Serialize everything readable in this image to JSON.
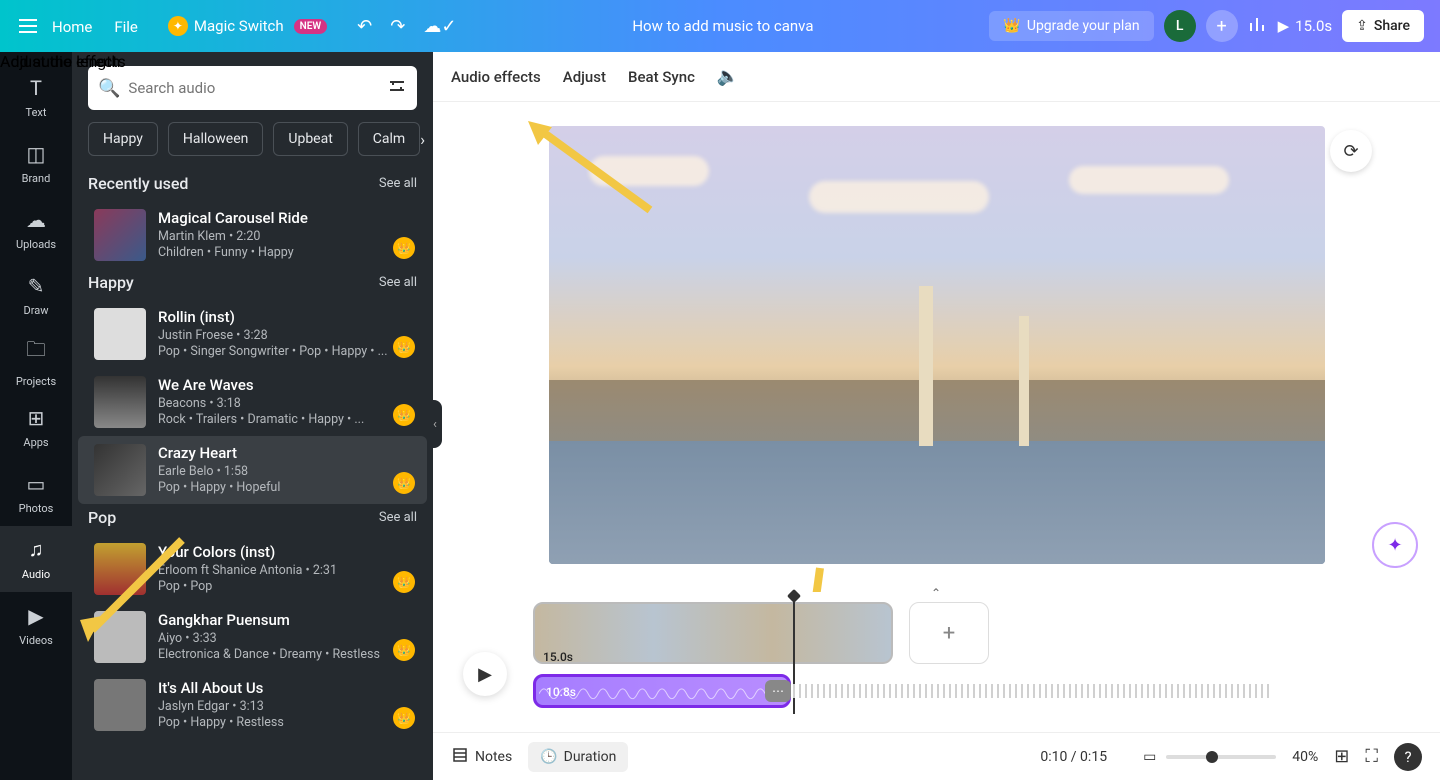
{
  "header": {
    "home": "Home",
    "file": "File",
    "magic": "Magic Switch",
    "new": "NEW",
    "title": "How to add music to canva",
    "upgrade": "Upgrade your plan",
    "avatar": "L",
    "duration": "15.0s",
    "share": "Share"
  },
  "rail": [
    {
      "icon": "T",
      "label": "Text"
    },
    {
      "icon": "◫",
      "label": "Brand"
    },
    {
      "icon": "☁",
      "label": "Uploads"
    },
    {
      "icon": "✎",
      "label": "Draw"
    },
    {
      "icon": "🗀",
      "label": "Projects"
    },
    {
      "icon": "⊞",
      "label": "Apps"
    },
    {
      "icon": "▭",
      "label": "Photos"
    },
    {
      "icon": "♫",
      "label": "Audio"
    },
    {
      "icon": "▶",
      "label": "Videos"
    }
  ],
  "search": {
    "placeholder": "Search audio"
  },
  "chips": [
    "Happy",
    "Halloween",
    "Upbeat",
    "Calm"
  ],
  "sections": {
    "recently": {
      "title": "Recently used",
      "see": "See all"
    },
    "happy": {
      "title": "Happy",
      "see": "See all"
    },
    "pop": {
      "title": "Pop",
      "see": "See all"
    }
  },
  "tracks": {
    "r0": {
      "t": "Magical Carousel Ride",
      "a": "Martin Klem • 2:20",
      "g": "Children • Funny • Happy"
    },
    "h0": {
      "t": "Rollin (inst)",
      "a": "Justin Froese • 3:28",
      "g": "Pop • Singer Songwriter • Pop • Happy • ..."
    },
    "h1": {
      "t": "We Are Waves",
      "a": "Beacons • 3:18",
      "g": "Rock • Trailers • Dramatic • Happy • ..."
    },
    "h2": {
      "t": "Crazy Heart",
      "a": "Earle Belo • 1:58",
      "g": "Pop • Happy • Hopeful"
    },
    "p0": {
      "t": "Your Colors (inst)",
      "a": "Erloom ft Shanice Antonia • 2:31",
      "g": "Pop • Pop"
    },
    "p1": {
      "t": "Gangkhar Puensum",
      "a": "Aiyo • 3:33",
      "g": "Electronica & Dance • Dreamy • Restless"
    },
    "p2": {
      "t": "It's All About Us",
      "a": "Jaslyn Edgar • 3:13",
      "g": "Pop • Happy • Restless"
    }
  },
  "subbar": {
    "a": "Audio effects",
    "b": "Adjust",
    "c": "Beat Sync"
  },
  "annot": {
    "a": "Add audio effects",
    "b": "Adjust the length"
  },
  "timeline": {
    "vid_dur": "15.0s",
    "aud_dur": "10.8s"
  },
  "bottom": {
    "notes": "Notes",
    "duration": "Duration",
    "time": "0:10 / 0:15",
    "zoom": "40%"
  }
}
